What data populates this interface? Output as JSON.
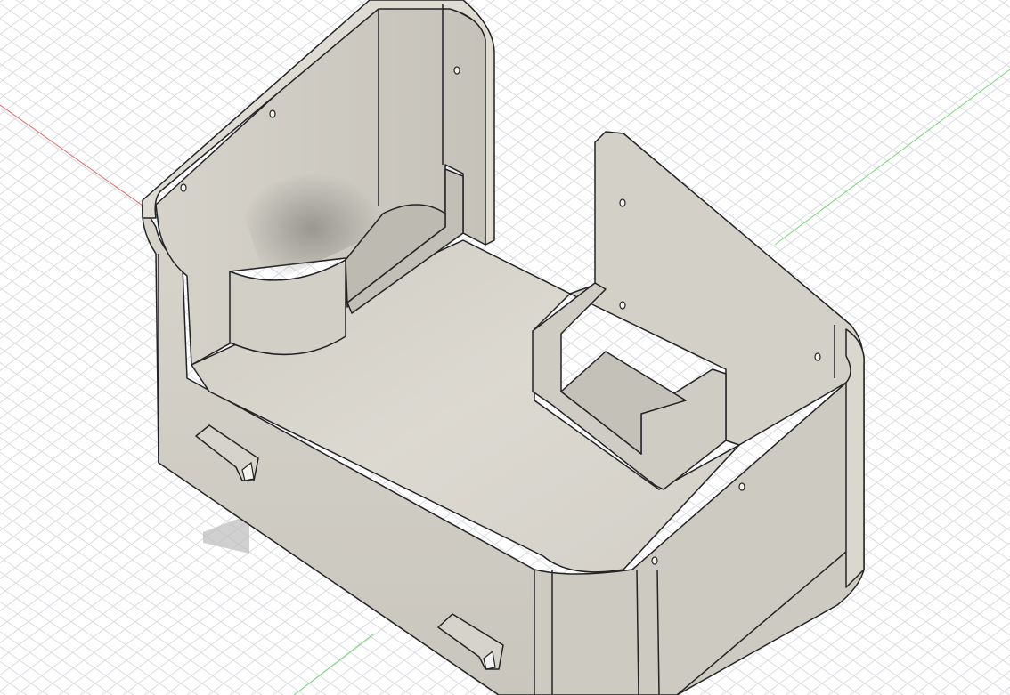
{
  "viewport": {
    "kind": "3d-model-view",
    "background": "#ffffff",
    "grid_color": "#d9dce0",
    "axis_x_color": "#e05555",
    "axis_y_color": "#55d455",
    "model_color": "#d8d6cf",
    "edge_color": "#2a2a2a"
  },
  "model": {
    "shape": "open-box-enclosure",
    "icons": [
      "screw-hole-icon",
      "hinge-tab-icon"
    ]
  }
}
